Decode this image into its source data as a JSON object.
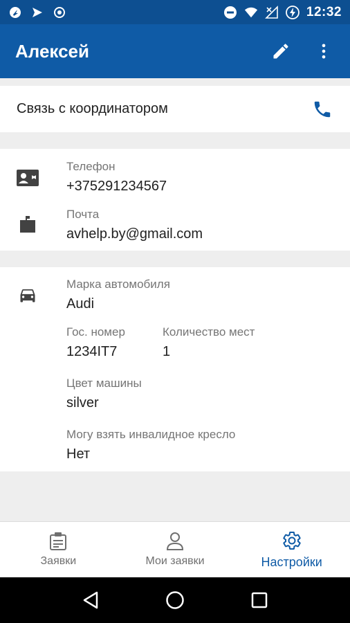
{
  "status_bar": {
    "time": "12:32",
    "icons_left": [
      "app-icon-1",
      "send-icon",
      "record-icon"
    ],
    "icons_right": [
      "dnd-icon",
      "wifi-icon",
      "signal-icon",
      "battery-charging-icon"
    ]
  },
  "app_bar": {
    "title": "Алексей",
    "edit_icon": "pencil-icon",
    "menu_icon": "more-vert-icon",
    "color": "#0f5ba6"
  },
  "coordinator": {
    "label": "Связь с координатором",
    "icon": "phone-icon"
  },
  "contacts": {
    "phone_label": "Телефон",
    "phone_value": "+375291234567",
    "mail_label": "Почта",
    "mail_value": "avhelp.by@gmail.com"
  },
  "car": {
    "brand_label": "Марка автомобиля",
    "brand_value": "Audi",
    "plate_label": "Гос. номер",
    "plate_value": "1234IT7",
    "seats_label": "Количество мест",
    "seats_value": "1",
    "color_label": "Цвет машины",
    "color_value": "silver",
    "wheelchair_label": "Могу взять инвалидное кресло",
    "wheelchair_value": "Нет"
  },
  "bottom_nav": {
    "items": [
      {
        "label": "Заявки",
        "icon": "requests-icon",
        "active": false
      },
      {
        "label": "Мои заявки",
        "icon": "person-icon",
        "active": false
      },
      {
        "label": "Настройки",
        "icon": "gear-icon",
        "active": true
      }
    ]
  },
  "system_nav": [
    "back-icon",
    "home-icon",
    "recents-icon"
  ]
}
